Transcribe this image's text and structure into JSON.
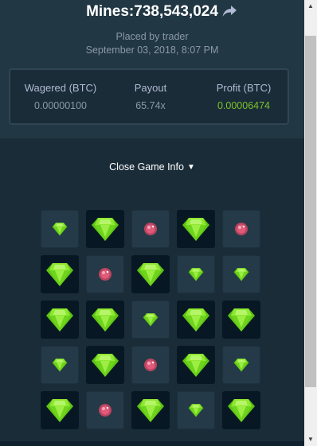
{
  "header": {
    "title": "Mines:738,543,024",
    "placed_by": "Placed by trader",
    "date": "September 03, 2018, 8:07 PM",
    "share_icon": "share-arrow-icon"
  },
  "stats": {
    "wagered_label": "Wagered (BTC)",
    "wagered_value": "0.00000100",
    "payout_label": "Payout",
    "payout_value": "65.74x",
    "profit_label": "Profit (BTC)",
    "profit_value": "0.00006474",
    "profit_color": "#7ec12b"
  },
  "close_info": {
    "label": "Close Game Info",
    "icon": "chevron-down-icon"
  },
  "grid": {
    "rows": 5,
    "cols": 5,
    "legend": {
      "G": "gem revealed (picked)",
      "g": "gem unrevealed",
      "m": "mine unrevealed"
    },
    "cells": [
      [
        "g",
        "G",
        "m",
        "G",
        "m"
      ],
      [
        "G",
        "m",
        "G",
        "g",
        "g"
      ],
      [
        "G",
        "G",
        "g",
        "G",
        "G"
      ],
      [
        "g",
        "G",
        "m",
        "G",
        "g"
      ],
      [
        "G",
        "m",
        "G",
        "g",
        "G"
      ]
    ]
  },
  "colors": {
    "background": "#1a2c38",
    "panel": "#213743",
    "tile_hidden": "#243a48",
    "tile_revealed": "#071824",
    "gem": "#80e024",
    "mine": "#e05a7a"
  }
}
